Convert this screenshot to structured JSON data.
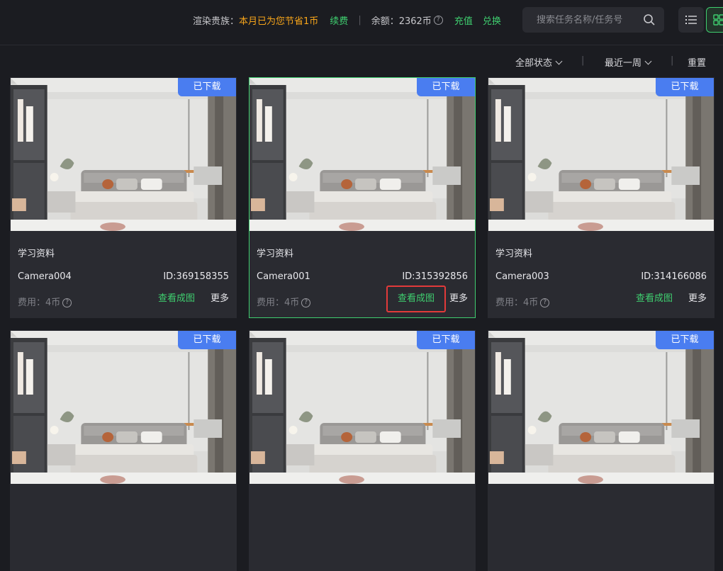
{
  "header": {
    "vip_label": "渲染贵族：",
    "vip_saving": "本月已为您节省1币",
    "renew": "续费",
    "balance_label": "余额：",
    "balance_value": "2362币",
    "recharge": "充值",
    "exchange": "兑换",
    "search_placeholder": "搜索任务名称/任务号"
  },
  "filters": {
    "status": "全部状态",
    "period": "最近一周",
    "reset": "重置"
  },
  "cards": [
    {
      "badge": "已下载",
      "title": "学习资料",
      "camera": "Camera004",
      "id": "ID:369158355",
      "cost": "费用：4币",
      "view": "查看成图",
      "more": "更多"
    },
    {
      "badge": "已下载",
      "title": "学习资料",
      "camera": "Camera001",
      "id": "ID:315392856",
      "cost": "费用：4币",
      "view": "查看成图",
      "more": "更多"
    },
    {
      "badge": "已下载",
      "title": "学习资料",
      "camera": "Camera003",
      "id": "ID:314166086",
      "cost": "费用：4币",
      "view": "查看成图",
      "more": "更多"
    },
    {
      "badge": "已下载"
    },
    {
      "badge": "已下载"
    },
    {
      "badge": "已下载"
    }
  ],
  "colors": {
    "accent_green": "#3fce6f",
    "badge_blue": "#4a7df0",
    "vip_orange": "#f7a51a",
    "highlight_red": "#e23a3a"
  },
  "icons": [
    "search-icon",
    "list-view-icon",
    "grid-view-icon",
    "help-icon",
    "chevron-down-icon"
  ]
}
